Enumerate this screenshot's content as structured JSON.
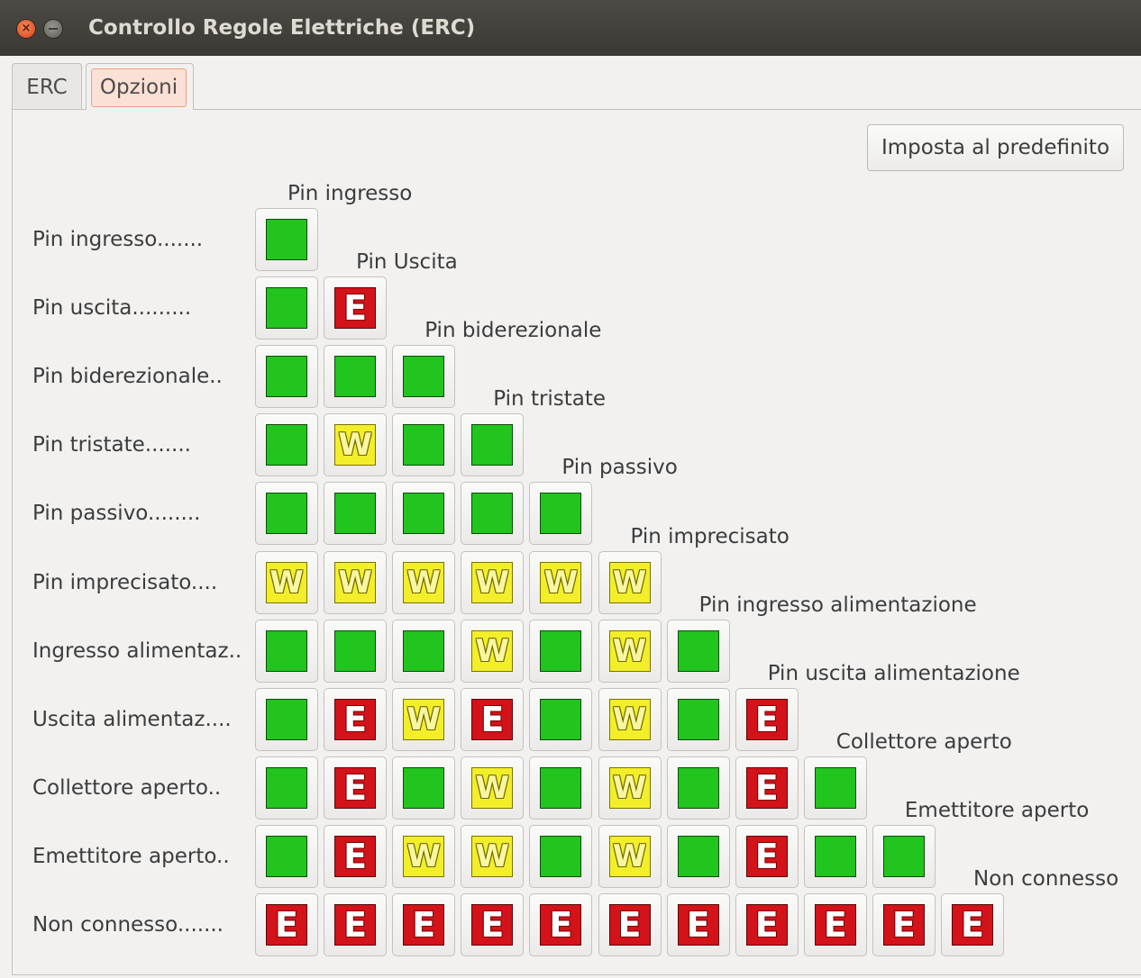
{
  "window": {
    "title": "Controllo Regole Elettriche (ERC)",
    "close_glyph": "×",
    "close_icon": "close-icon",
    "minimize_icon": "minimize-icon"
  },
  "tabs": [
    {
      "label": "ERC",
      "active": false
    },
    {
      "label": "Opzioni",
      "active": true
    }
  ],
  "reset_button": {
    "label": "Imposta al predefinito"
  },
  "rows": [
    "Pin ingresso.......",
    "Pin uscita.........",
    "Pin biderezionale..",
    "Pin tristate.......",
    "Pin passivo........",
    "Pin imprecisato....",
    "Ingresso alimentaz..",
    "Uscita alimentaz....",
    "Collettore aperto..",
    "Emettitore aperto..",
    "Non connesso......."
  ],
  "columns": [
    "Pin ingresso",
    "Pin Uscita",
    "Pin biderezionale",
    "Pin tristate",
    "Pin passivo",
    "Pin imprecisato",
    "Pin ingresso alimentazione",
    "Pin uscita alimentazione",
    "Collettore aperto",
    "Emettitore aperto",
    "Non connesso"
  ],
  "legend": {
    "ok": {
      "glyph": "",
      "color": "#22c41e"
    },
    "warn": {
      "glyph": "W",
      "color": "#f2ee2a"
    },
    "err": {
      "glyph": "E",
      "color": "#d3121a"
    }
  },
  "matrix": [
    [
      "ok"
    ],
    [
      "ok",
      "err"
    ],
    [
      "ok",
      "ok",
      "ok"
    ],
    [
      "ok",
      "warn",
      "ok",
      "ok"
    ],
    [
      "ok",
      "ok",
      "ok",
      "ok",
      "ok"
    ],
    [
      "warn",
      "warn",
      "warn",
      "warn",
      "warn",
      "warn"
    ],
    [
      "ok",
      "ok",
      "ok",
      "warn",
      "ok",
      "warn",
      "ok"
    ],
    [
      "ok",
      "err",
      "warn",
      "err",
      "ok",
      "warn",
      "ok",
      "err"
    ],
    [
      "ok",
      "err",
      "ok",
      "warn",
      "ok",
      "warn",
      "ok",
      "err",
      "ok"
    ],
    [
      "ok",
      "err",
      "warn",
      "warn",
      "ok",
      "warn",
      "ok",
      "err",
      "ok",
      "ok"
    ],
    [
      "err",
      "err",
      "err",
      "err",
      "err",
      "err",
      "err",
      "err",
      "err",
      "err",
      "err"
    ]
  ]
}
